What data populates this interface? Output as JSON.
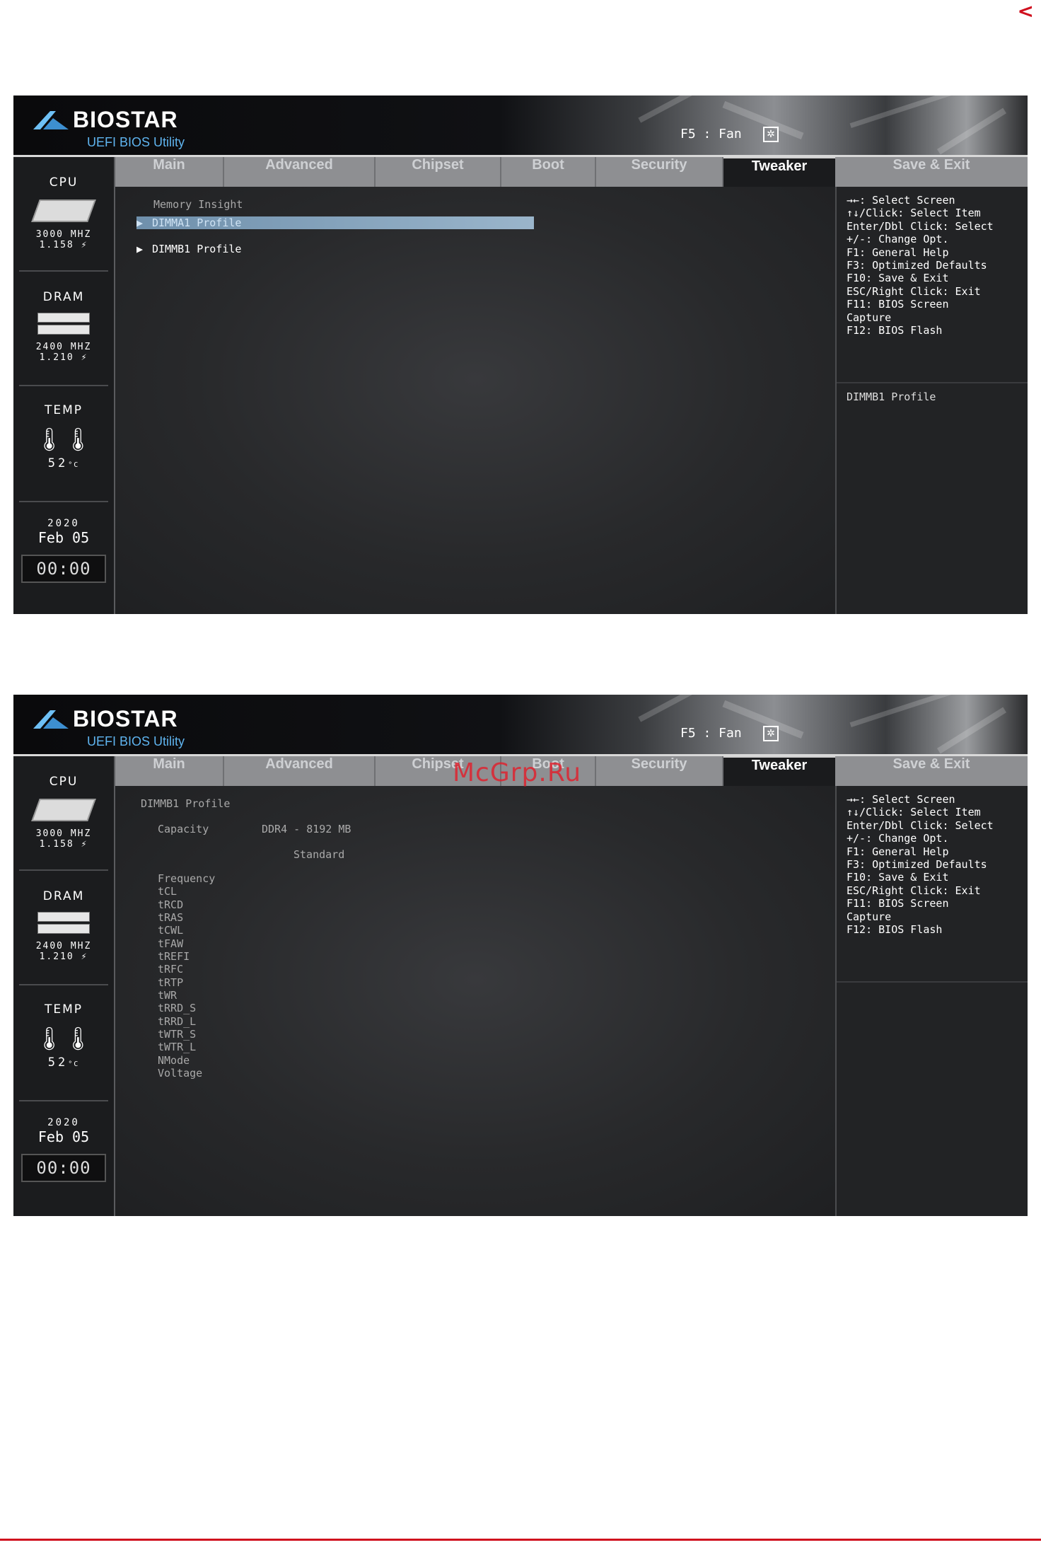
{
  "page": {
    "corner_arrow": "<",
    "watermark": "McGrp.Ru"
  },
  "bios": {
    "logo_text": "BIOSTAR",
    "logo_subtitle": "UEFI BIOS Utility",
    "hotkey": "F5 : Fan",
    "tabs": [
      "Main",
      "Advanced",
      "Chipset",
      "Boot",
      "Security",
      "Tweaker"
    ],
    "save_tab": "Save & Exit",
    "sidebar": {
      "cpu": {
        "title": "CPU",
        "freq": "3000 MHZ",
        "volt": "1.158"
      },
      "dram": {
        "title": "DRAM",
        "freq": "2400 MHZ",
        "volt": "1.210"
      },
      "temp": {
        "title": "TEMP",
        "value": "52"
      },
      "date": {
        "year": "2020",
        "month": "Feb",
        "day": "05"
      },
      "clock": "00:00"
    },
    "help": "→←: Select Screen\n↑↓/Click: Select Item\nEnter/Dbl Click: Select\n+/-: Change Opt.\nF1: General Help\nF3: Optimized Defaults\nF10: Save & Exit\nESC/Right Click: Exit\nF11: BIOS Screen\nCapture\nF12: BIOS Flash"
  },
  "screen1": {
    "title": "Memory Insight",
    "items": [
      "DIMMA1 Profile",
      "DIMMB1 Profile"
    ],
    "selected_index": 0,
    "help_description": "DIMMB1 Profile"
  },
  "screen2": {
    "title": "DIMMB1 Profile",
    "capacity_label": "Capacity",
    "capacity_value": "DDR4 - 8192 MB",
    "column_header": "Standard",
    "rows": [
      "Frequency",
      "tCL",
      "tRCD",
      "tRAS",
      "tCWL",
      "tFAW",
      "tREFI",
      "tRFC",
      "tRTP",
      "tWR",
      "tRRD_S",
      "tRRD_L",
      "tWTR_S",
      "tWTR_L",
      "NMode",
      "Voltage"
    ]
  }
}
